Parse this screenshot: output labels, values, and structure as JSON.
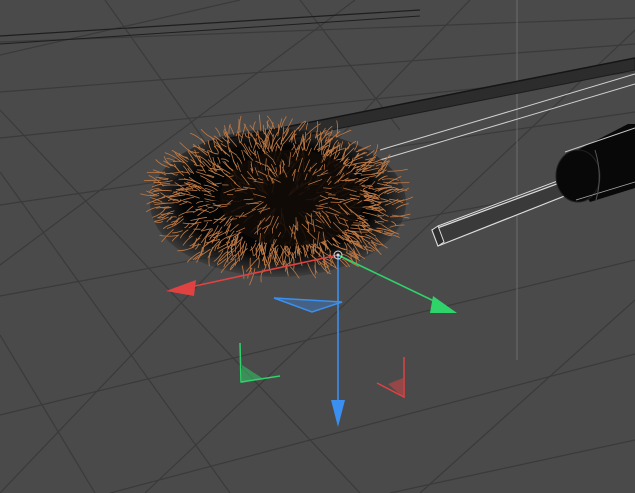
{
  "viewport": {
    "background": "#4a4a4a",
    "grid_color": "#3a3a3a",
    "grid_highlight": "#6c6c6c"
  },
  "scene": {
    "objects": [
      {
        "name": "hair-mesh",
        "color": "#c07a45",
        "shadow": "#120b08"
      },
      {
        "name": "handle-rod",
        "color": "#1a1a1a",
        "outline": "#dcdcdc"
      },
      {
        "name": "cylinder-grip",
        "color": "#080808",
        "outline": "#c8c8c8"
      }
    ]
  },
  "gizmo": {
    "x_axis_color": "#e04242",
    "y_axis_color": "#2fd36a",
    "z_axis_color": "#3b8ff0",
    "handles": [
      "x-axis-arrow",
      "y-axis-arrow",
      "z-axis-arrow",
      "xy-plane-handle",
      "yz-plane-handle",
      "xz-plane-handle"
    ]
  }
}
